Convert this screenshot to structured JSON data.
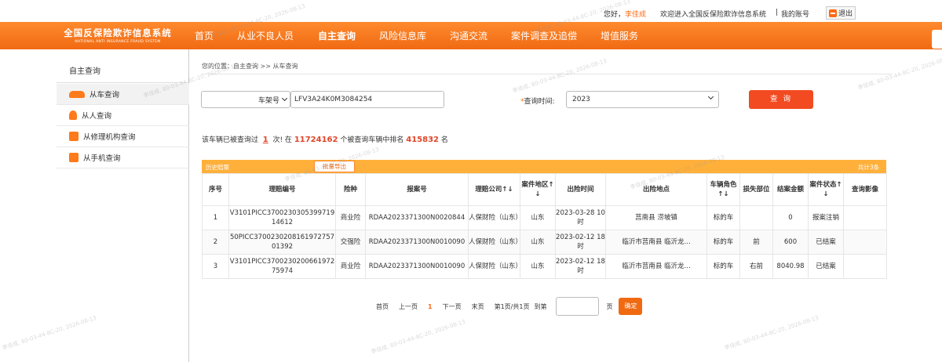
{
  "topbar": {
    "greeting": "您好，",
    "user": "李佳成",
    "welcome": "欢迎进入全国反保险欺诈信息系统",
    "separator": "|",
    "my_account": "我的账号",
    "logout": "退出"
  },
  "logo": {
    "cn": "全国反保险欺诈信息系统",
    "en": "NATIONAL ANTI INSURANCE FRAUD SYSTEM"
  },
  "nav": [
    "首页",
    "从业不良人员",
    "自主查询",
    "风险信息库",
    "沟通交流",
    "案件调查及追偿",
    "增值服务"
  ],
  "sidebar": {
    "title": "自主查询",
    "items": [
      {
        "label": "从车查询",
        "icon": "car-icon"
      },
      {
        "label": "从人查询",
        "icon": "person-icon"
      },
      {
        "label": "从修理机构查询",
        "icon": "repair-shop-icon"
      },
      {
        "label": "从手机查询",
        "icon": "phone-icon"
      }
    ]
  },
  "breadcrumb": "您的位置：自主查询 >> 从车查询",
  "search": {
    "field_type": "车架号",
    "vin": "LFV3A24K0M3084254",
    "required_mark": "*",
    "time_label": "查询时间:",
    "time_value": "2023",
    "query_button": "查 询"
  },
  "stats": {
    "p1": "该车辆已被查询过",
    "count": "1",
    "p2": "次! 在",
    "total": "11724162",
    "p3": "个被查询车辆中排名",
    "rank": "415832",
    "p4": "名"
  },
  "history": {
    "title": "历史赔案",
    "export": "批量导出",
    "total": "共计3条"
  },
  "table": {
    "headers": [
      "序号",
      "理赔编号",
      "险种",
      "报案号",
      "理赔公司↑↓",
      "案件地区↑↓",
      "出险时间",
      "出险地点",
      "车辆角色↑↓",
      "损失部位",
      "结案金额",
      "案件状态↑↓",
      "查询影像"
    ],
    "rows": [
      [
        "1",
        "V3101PICC370023030539971914612",
        "商业险",
        "RDAA2023371300N0020844",
        "人保财险（山东）",
        "山东",
        "2023-03-28 10时",
        "莒南县 涝坡镇",
        "标的车",
        "",
        "0",
        "报案注销",
        ""
      ],
      [
        "2",
        "50PICC370023020816197275701392",
        "交强险",
        "RDAA2023371300N0010090",
        "人保财险（山东）",
        "山东",
        "2023-02-12 18时",
        "临沂市莒南县 临沂龙...",
        "标的车",
        "前",
        "600",
        "已结案",
        ""
      ],
      [
        "3",
        "V3101PICC370023020066197275974",
        "商业险",
        "RDAA2023371300N0010090",
        "人保财险（山东）",
        "山东",
        "2023-02-12 18时",
        "临沂市莒南县 临沂龙...",
        "标的车",
        "右前",
        "8040.98",
        "已结案",
        ""
      ]
    ]
  },
  "pager": {
    "first": "首页",
    "prev": "上一页",
    "current": "1",
    "next": "下一页",
    "last": "末页",
    "info": "第1页/共1页",
    "goto": "到第",
    "page_unit": "页",
    "go": "确定"
  },
  "watermark": "李佳成, 80-03-44-8C-20, 2026-08-13"
}
